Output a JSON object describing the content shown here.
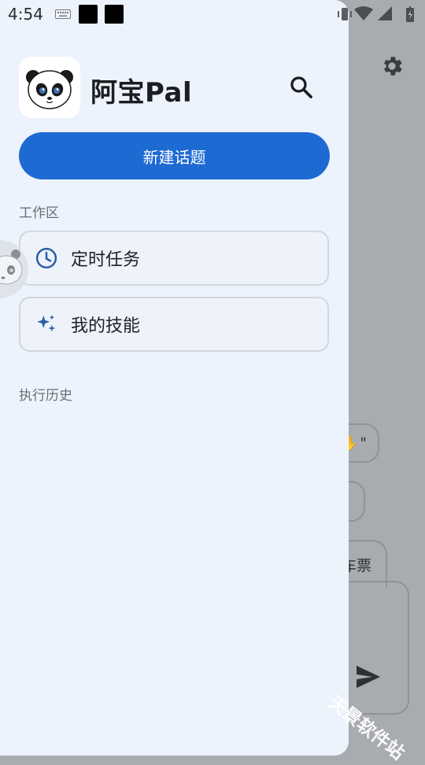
{
  "status_bar": {
    "time": "4:54"
  },
  "drawer": {
    "app_title": "阿宝Pal",
    "new_topic_label": "新建话题",
    "workspace_label": "工作区",
    "items": [
      {
        "label": "定时任务",
        "icon": "clock-icon"
      },
      {
        "label": "我的技能",
        "icon": "sparkle-icon"
      }
    ],
    "history_label": "执行历史"
  },
  "background": {
    "chips": [
      "\"",
      "",
      "车票"
    ],
    "watermark": "天景软件站"
  },
  "colors": {
    "accent": "#1e6ad3",
    "drawer_bg": "#edf3fc",
    "scrim": "#a8abb0",
    "icon_blue": "#2b5fa6"
  }
}
